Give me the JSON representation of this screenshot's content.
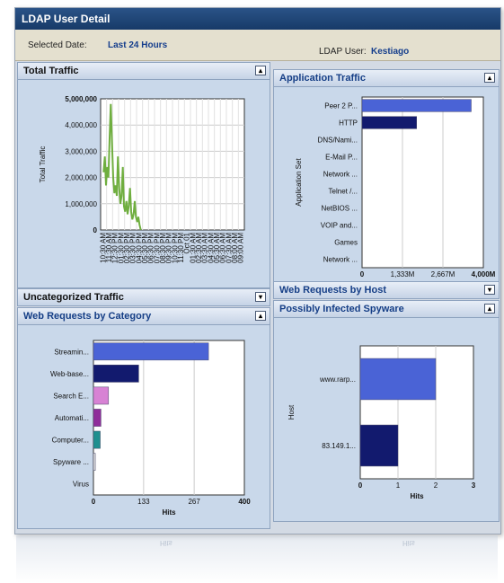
{
  "window": {
    "title": "LDAP User Detail"
  },
  "selection": {
    "date_label": "Selected Date:",
    "date_value": "Last 24 Hours",
    "user_label": "LDAP User:",
    "user_value": "Kestiago"
  },
  "panels": {
    "total_traffic": {
      "title": "Total Traffic",
      "toggle": "▴"
    },
    "application_traffic": {
      "title": "Application Traffic",
      "toggle": "▴"
    },
    "uncategorized_traffic": {
      "title": "Uncategorized Traffic",
      "toggle": "▾"
    },
    "web_requests_by_host": {
      "title": "Web Requests by Host",
      "toggle": "▾"
    },
    "web_requests_by_category": {
      "title": "Web Requests by Category",
      "toggle": "▴"
    },
    "possibly_infected_spyware": {
      "title": "Possibly Infected Spyware",
      "toggle": "▴"
    }
  },
  "reflection": {
    "text": "Hits"
  },
  "colors": {
    "title_bar": "#1f4678",
    "panel_bg": "#c9d8ea",
    "line_series": "#6fae3f",
    "bar_blue": "#4a63d6",
    "bar_navy": "#121a6e",
    "bar_pink": "#d782d4",
    "bar_purple": "#8f2d9a",
    "bar_teal": "#1f8f8f"
  },
  "chart_data": [
    {
      "id": "total_traffic",
      "type": "line",
      "title": "",
      "ylabel": "Total Traffic",
      "xlabel": "",
      "ylim": [
        0,
        5000000
      ],
      "yticks": [
        0,
        1000000,
        2000000,
        3000000,
        4000000,
        5000000
      ],
      "ytick_labels": [
        "0",
        "1,000,000",
        "2,000,000",
        "3,000,000",
        "4,000,000",
        "5,000,000"
      ],
      "x_categories": [
        "10:30 AM",
        "11:30 AM",
        "12:30 PM",
        "01:30 PM",
        "02:30 PM",
        "03:30 PM",
        "04:30 PM",
        "05:30 PM",
        "06:30 PM",
        "07:30 PM",
        "08:30 PM",
        "09:30 PM",
        "10:30 PM",
        "11:30 PM",
        "Oct 01",
        "01:30 AM",
        "02:30 AM",
        "03:30 AM",
        "04:30 AM",
        "05:30 AM",
        "06:30 AM",
        "07:30 AM",
        "08:00 AM",
        "09:00 AM"
      ],
      "x": [
        0,
        0.2,
        0.4,
        0.6,
        0.8,
        1.0,
        1.2,
        1.4,
        1.6,
        1.8,
        2.0,
        2.2,
        2.4,
        2.6,
        2.8,
        3.0,
        3.2,
        3.4,
        3.6,
        3.8,
        4.0,
        4.2,
        4.4,
        4.6,
        4.8,
        5.0,
        5.2,
        5.4,
        5.6,
        5.8,
        6.0,
        6.2
      ],
      "values": [
        2200000,
        2800000,
        1700000,
        2400000,
        2000000,
        3500000,
        4800000,
        3300000,
        2000000,
        1400000,
        1700000,
        1300000,
        2800000,
        1600000,
        1000000,
        1300000,
        2400000,
        900000,
        700000,
        1100000,
        600000,
        900000,
        1600000,
        700000,
        400000,
        600000,
        1100000,
        500000,
        300000,
        500000,
        200000,
        0
      ],
      "grid": true,
      "legend": "none"
    },
    {
      "id": "application_traffic",
      "type": "bar",
      "orientation": "horizontal",
      "ylabel": "Application Set",
      "xlabel": "",
      "categories": [
        "Peer 2 P...",
        "HTTP",
        "DNS/Nami...",
        "E-Mail P...",
        "Network ...",
        "Telnet /...",
        "NetBIOS ...",
        "VOIP and...",
        "Games",
        "Network ..."
      ],
      "values": [
        3600,
        1800,
        0,
        0,
        0,
        0,
        0,
        0,
        0,
        0
      ],
      "bar_colors": [
        "#4a63d6",
        "#121a6e",
        "#4a63d6",
        "#4a63d6",
        "#4a63d6",
        "#4a63d6",
        "#4a63d6",
        "#4a63d6",
        "#4a63d6",
        "#4a63d6"
      ],
      "xlim": [
        0,
        4000
      ],
      "xticks": [
        0,
        1333,
        2667,
        4000
      ],
      "xtick_labels": [
        "0",
        "1,333M",
        "2,667M",
        "4,000M"
      ],
      "grid": true,
      "legend": "none"
    },
    {
      "id": "web_requests_by_category",
      "type": "bar",
      "orientation": "horizontal",
      "xlabel": "Hits",
      "ylabel": "",
      "categories": [
        "Streamin...",
        "Web-base...",
        "Search E...",
        "Automati...",
        "Computer...",
        "Spyware ...",
        "Virus"
      ],
      "values": [
        305,
        120,
        40,
        20,
        18,
        5,
        0
      ],
      "bar_colors": [
        "#4a63d6",
        "#121a6e",
        "#d782d4",
        "#8f2d9a",
        "#1f8f8f",
        "#dddddd",
        "#dddddd"
      ],
      "xlim": [
        0,
        400
      ],
      "xticks": [
        0,
        133,
        267,
        400
      ],
      "xtick_labels": [
        "0",
        "133",
        "267",
        "400"
      ],
      "grid": true,
      "legend": "none"
    },
    {
      "id": "possibly_infected_spyware",
      "type": "bar",
      "orientation": "horizontal",
      "xlabel": "Hits",
      "ylabel": "Host",
      "categories": [
        "www.rarp...",
        "83.149.1..."
      ],
      "values": [
        2,
        1
      ],
      "bar_colors": [
        "#4a63d6",
        "#121a6e"
      ],
      "xlim": [
        0,
        3
      ],
      "xticks": [
        0,
        1,
        2,
        3
      ],
      "xtick_labels": [
        "0",
        "1",
        "2",
        "3"
      ],
      "grid": true,
      "legend": "none"
    }
  ]
}
